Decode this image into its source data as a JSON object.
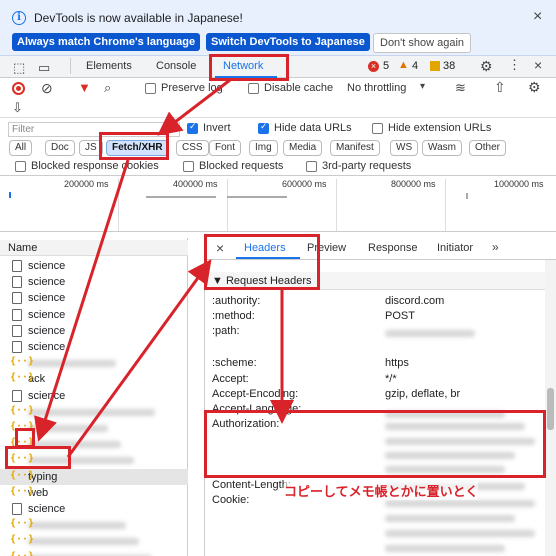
{
  "infobar": {
    "message": "DevTools is now available in Japanese!",
    "btn_match": "Always match Chrome's language",
    "btn_switch": "Switch DevTools to Japanese",
    "btn_dont_show": "Don't show again"
  },
  "tabs": {
    "elements": "Elements",
    "console": "Console",
    "network": "Network"
  },
  "badges": {
    "errors": "5",
    "warnings": "4",
    "info": "38"
  },
  "toolbar": {
    "preserve_log": "Preserve log",
    "disable_cache": "Disable cache",
    "throttling": "No throttling"
  },
  "filter": {
    "placeholder": "Filter",
    "invert": "Invert",
    "hide_data_urls": "Hide data URLs",
    "hide_extension_urls": "Hide extension URLs",
    "types": [
      "All",
      "Doc",
      "JS",
      "Fetch/XHR",
      "CSS",
      "Font",
      "Img",
      "Media",
      "Manifest",
      "WS",
      "Wasm",
      "Other"
    ],
    "blocked_cookies": "Blocked response cookies",
    "blocked_requests": "Blocked requests",
    "third_party": "3rd-party requests"
  },
  "timeline": {
    "ticks": [
      "200000 ms",
      "400000 ms",
      "600000 ms",
      "800000 ms",
      "1000000 ms"
    ]
  },
  "requests": {
    "header": "Name",
    "rows": [
      "science",
      "science",
      "science",
      "science",
      "science",
      "science",
      "",
      "ack",
      "science",
      "",
      "",
      "",
      "",
      "typing",
      "web",
      "science",
      "",
      "",
      ""
    ]
  },
  "details": {
    "tabs": [
      "Headers",
      "Preview",
      "Response",
      "Initiator"
    ],
    "section": "Request Headers",
    "headers": [
      {
        "key": ":authority:",
        "value": "discord.com"
      },
      {
        "key": ":method:",
        "value": "POST"
      },
      {
        "key": ":path:",
        "value": ""
      },
      {
        "key": ":scheme:",
        "value": "https"
      },
      {
        "key": "Accept:",
        "value": "*/*"
      },
      {
        "key": "Accept-Encoding:",
        "value": "gzip, deflate, br"
      },
      {
        "key": "Accept-Language:",
        "value": ""
      },
      {
        "key": "Authorization:",
        "value": ""
      },
      {
        "key": "Content-Length:",
        "value": ""
      },
      {
        "key": "Cookie:",
        "value": ""
      }
    ]
  },
  "annotation": {
    "note": "コピーしてメモ帳とかに置いとく",
    "color": "#d8232a"
  },
  "colors": {
    "accent": "#1a73e8",
    "infobar_bg": "#e8f0fe",
    "primary_button": "#0b57d0"
  }
}
